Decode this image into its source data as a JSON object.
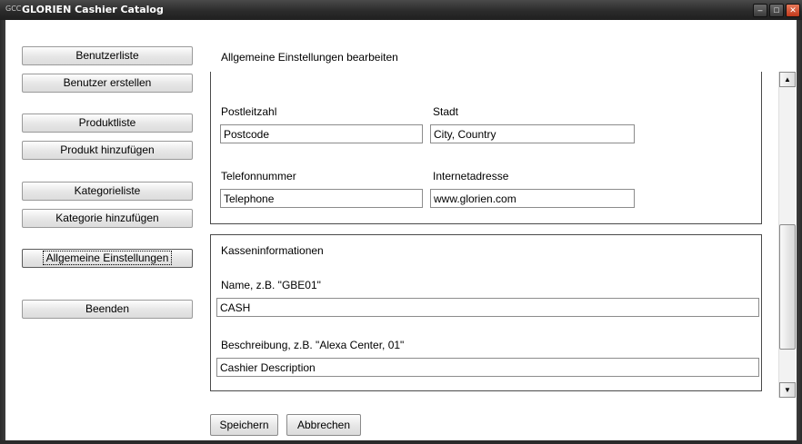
{
  "window": {
    "app_icon": "GCC",
    "title": "GLORIEN Cashier Catalog",
    "controls": {
      "minimize_icon": "minimize-icon",
      "maximize_icon": "maximize-icon",
      "close_icon": "close-icon"
    }
  },
  "nav": {
    "user_list": "Benutzerliste",
    "create_user": "Benutzer erstellen",
    "product_list": "Produktliste",
    "add_product": "Produkt hinzufügen",
    "category_list": "Kategorieliste",
    "add_category": "Kategorie hinzufügen",
    "general_settings": "Allgemeine Einstellungen",
    "exit": "Beenden"
  },
  "main": {
    "heading": "Allgemeine Einstellungen bearbeiten",
    "address": {
      "postcode_label": "Postleitzahl",
      "postcode_value": "Postcode",
      "city_label": "Stadt",
      "city_value": "City, Country",
      "phone_label": "Telefonnummer",
      "phone_value": "Telephone",
      "web_label": "Internetadresse",
      "web_value": "www.glorien.com"
    },
    "cashier": {
      "section_title": "Kasseninformationen",
      "name_label": "Name, z.B. \"GBE01\"",
      "name_value": "CASH",
      "desc_label": "Beschreibung, z.B. \"Alexa Center, 01\"",
      "desc_value": "Cashier Description"
    }
  },
  "actions": {
    "save": "Speichern",
    "cancel": "Abbrechen"
  }
}
